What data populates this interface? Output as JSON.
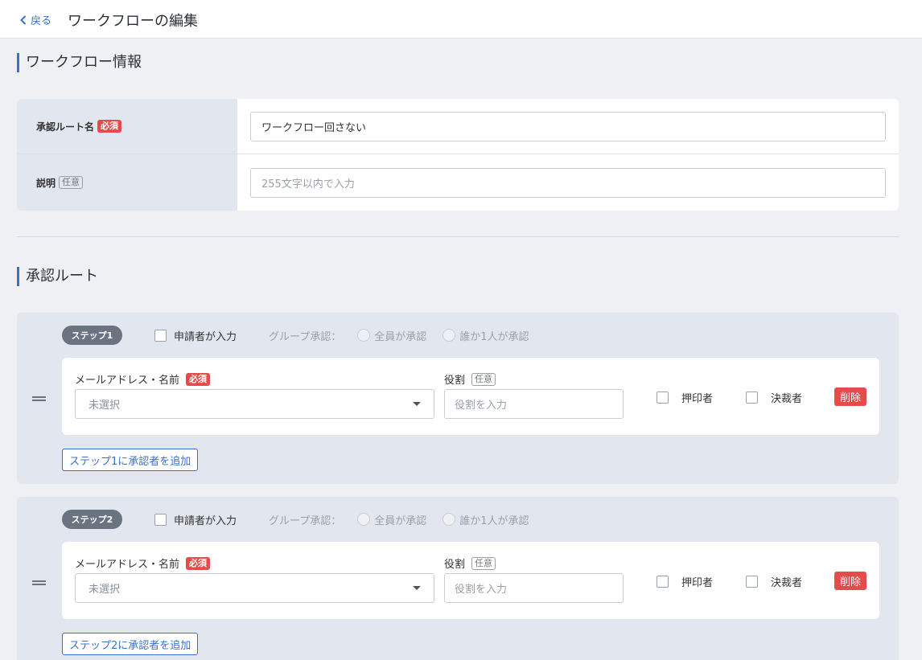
{
  "header": {
    "back_label": "戻る",
    "title": "ワークフローの編集"
  },
  "workflow_info": {
    "section_title": "ワークフロー情報",
    "route_name_label": "承認ルート名",
    "required_badge": "必須",
    "route_name_value": "ワークフロー回さない",
    "description_label": "説明",
    "optional_badge": "任意",
    "description_placeholder": "255文字以内で入力"
  },
  "approval_route": {
    "section_title": "承認ルート",
    "steps": [
      {
        "pill": "ステップ1",
        "applicant_input_label": "申請者が入力",
        "group_label": "グループ承認：",
        "radio_all": "全員が承認",
        "radio_any": "誰か1人が承認",
        "email_label": "メールアドレス・名前",
        "email_required": "必須",
        "select_value": "未選択",
        "role_label": "役割",
        "role_optional": "任意",
        "role_placeholder": "役割を入力",
        "stamper_label": "押印者",
        "approver_label": "決裁者",
        "delete_label": "削除",
        "add_label": "ステップ1に承認者を追加"
      },
      {
        "pill": "ステップ2",
        "applicant_input_label": "申請者が入力",
        "group_label": "グループ承認：",
        "radio_all": "全員が承認",
        "radio_any": "誰か1人が承認",
        "email_label": "メールアドレス・名前",
        "email_required": "必須",
        "select_value": "未選択",
        "role_label": "役割",
        "role_optional": "任意",
        "role_placeholder": "役割を入力",
        "stamper_label": "押印者",
        "approver_label": "決裁者",
        "delete_label": "削除",
        "add_label": "ステップ2に承認者を追加"
      }
    ]
  },
  "colors": {
    "accent": "#3a6fd0",
    "danger": "#e64b4b",
    "step_pill": "#6b7380"
  }
}
